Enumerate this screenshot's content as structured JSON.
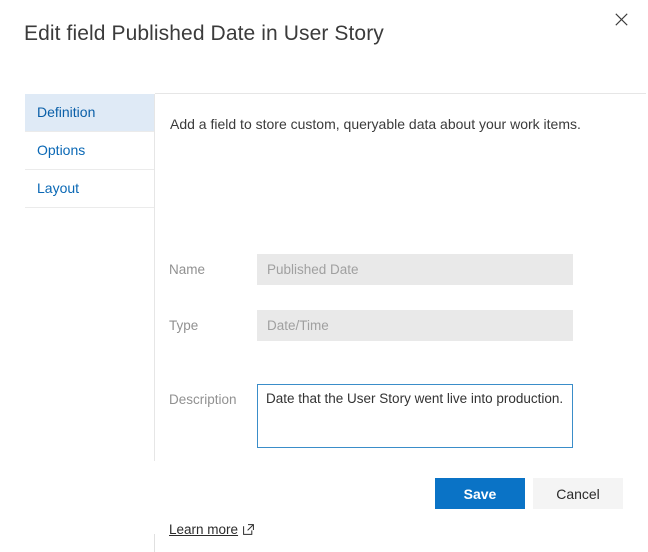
{
  "dialog": {
    "title": "Edit field Published Date in User Story",
    "close_icon": "close-icon"
  },
  "sidebar": {
    "items": [
      {
        "label": "Definition",
        "selected": true
      },
      {
        "label": "Options",
        "selected": false
      },
      {
        "label": "Layout",
        "selected": false
      }
    ]
  },
  "content": {
    "intro": "Add a field to store custom, queryable data about your work items.",
    "fields": [
      {
        "label": "Name",
        "value": "Published Date",
        "placeholder": "Published Date",
        "disabled": true
      },
      {
        "label": "Type",
        "value": "Date/Time",
        "placeholder": "Date/Time",
        "disabled": true
      },
      {
        "label": "Description",
        "value": "Date that the User Story went live into production.",
        "placeholder": "Description",
        "disabled": false
      }
    ],
    "learn_more": {
      "label": "Learn more",
      "icon": "external-link-icon"
    }
  },
  "footer": {
    "save_label": "Save",
    "cancel_label": "Cancel"
  },
  "colors": {
    "accent": "#0a73c6",
    "sidebar_selected_bg": "#dfeaf6",
    "sidebar_text": "#0a68b5",
    "disabled_field_bg": "#e9e9e9",
    "focus_border": "#3a8dc9",
    "cancel_bg": "#f4f4f4"
  }
}
